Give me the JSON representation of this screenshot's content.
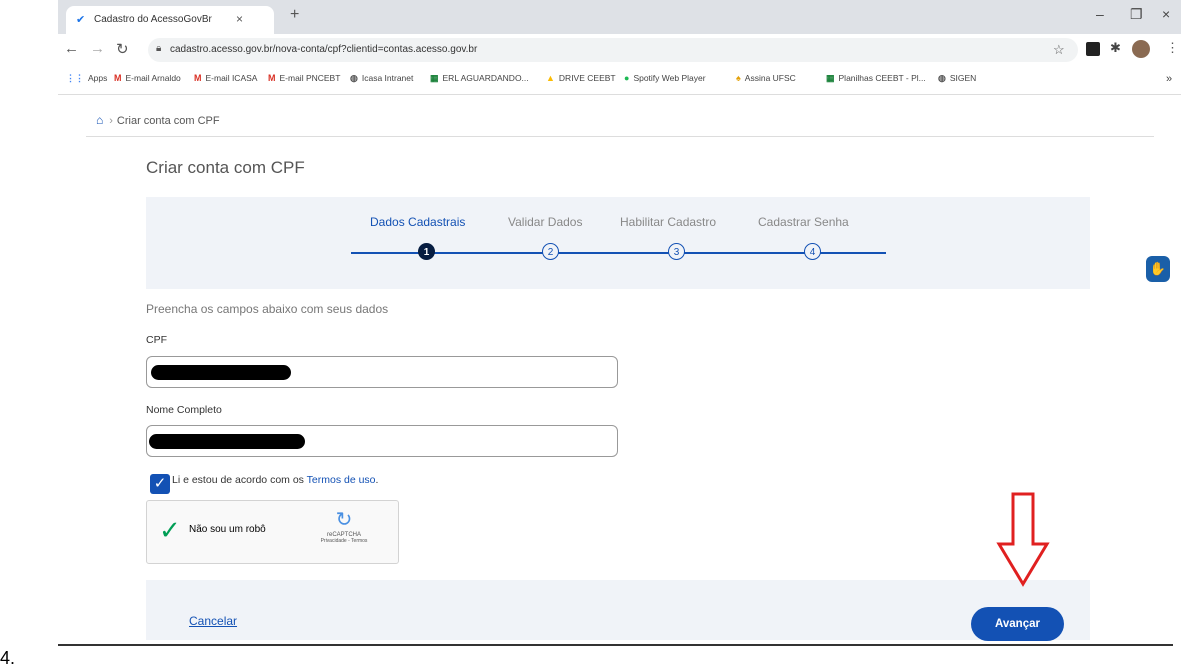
{
  "browser": {
    "tab_title": "Cadastro do AcessoGovBr",
    "tab_close": "×",
    "new_tab": "+",
    "url": "cadastro.acesso.gov.br/nova-conta/cpf?clientid=contas.acesso.gov.br",
    "window_min": "–",
    "window_max": "❐",
    "window_close": "×",
    "bookmarks": [
      {
        "label": "Apps",
        "icon": "apps-icon",
        "glyph": "⋮⋮",
        "color": "#4285f4"
      },
      {
        "label": "E-mail Arnaldo",
        "icon": "gmail-icon",
        "glyph": "M",
        "color": "#d93025"
      },
      {
        "label": "E-mail ICASA",
        "icon": "gmail-icon",
        "glyph": "M",
        "color": "#d93025"
      },
      {
        "label": "E-mail PNCEBT",
        "icon": "gmail-icon",
        "glyph": "M",
        "color": "#d93025"
      },
      {
        "label": "Icasa Intranet",
        "icon": "globe-icon",
        "glyph": "◍",
        "color": "#555"
      },
      {
        "label": "ERL AGUARDANDO...",
        "icon": "sheets-icon",
        "glyph": "▦",
        "color": "#188038"
      },
      {
        "label": "DRIVE CEEBT",
        "icon": "drive-icon",
        "glyph": "▲",
        "color": "#fbbc04"
      },
      {
        "label": "Spotify Web Player",
        "icon": "spotify-icon",
        "glyph": "●",
        "color": "#1db954"
      },
      {
        "label": "Assina UFSC",
        "icon": "assina-icon",
        "glyph": "♠",
        "color": "#e3a008"
      },
      {
        "label": "Planilhas CEEBT - Pl...",
        "icon": "sheets-icon",
        "glyph": "▦",
        "color": "#188038"
      },
      {
        "label": "SIGEN",
        "icon": "globe-icon",
        "glyph": "◍",
        "color": "#555"
      }
    ],
    "bookmarks_more": "»"
  },
  "breadcrumb": {
    "current": "Criar conta com CPF"
  },
  "page": {
    "title": "Criar conta com CPF",
    "steps": [
      {
        "label": "Dados Cadastrais",
        "number": "1",
        "active": true
      },
      {
        "label": "Validar Dados",
        "number": "2",
        "active": false
      },
      {
        "label": "Habilitar Cadastro",
        "number": "3",
        "active": false
      },
      {
        "label": "Cadastrar Senha",
        "number": "4",
        "active": false
      }
    ],
    "instructions": "Preencha os campos abaixo com seus dados",
    "cpf_label": "CPF",
    "name_label": "Nome Completo",
    "terms_prefix": "Li e estou de acordo com os ",
    "terms_link": "Termos de uso",
    "terms_suffix": ".",
    "terms_checked": true,
    "captcha": {
      "label": "Não sou um robô",
      "brand": "reCAPTCHA",
      "privacy": "Privacidade - Termos",
      "checked": true
    },
    "cancel_label": "Cancelar",
    "advance_label": "Avançar"
  },
  "annotation": {
    "arrow_color": "#e02020"
  },
  "list_number": "4."
}
